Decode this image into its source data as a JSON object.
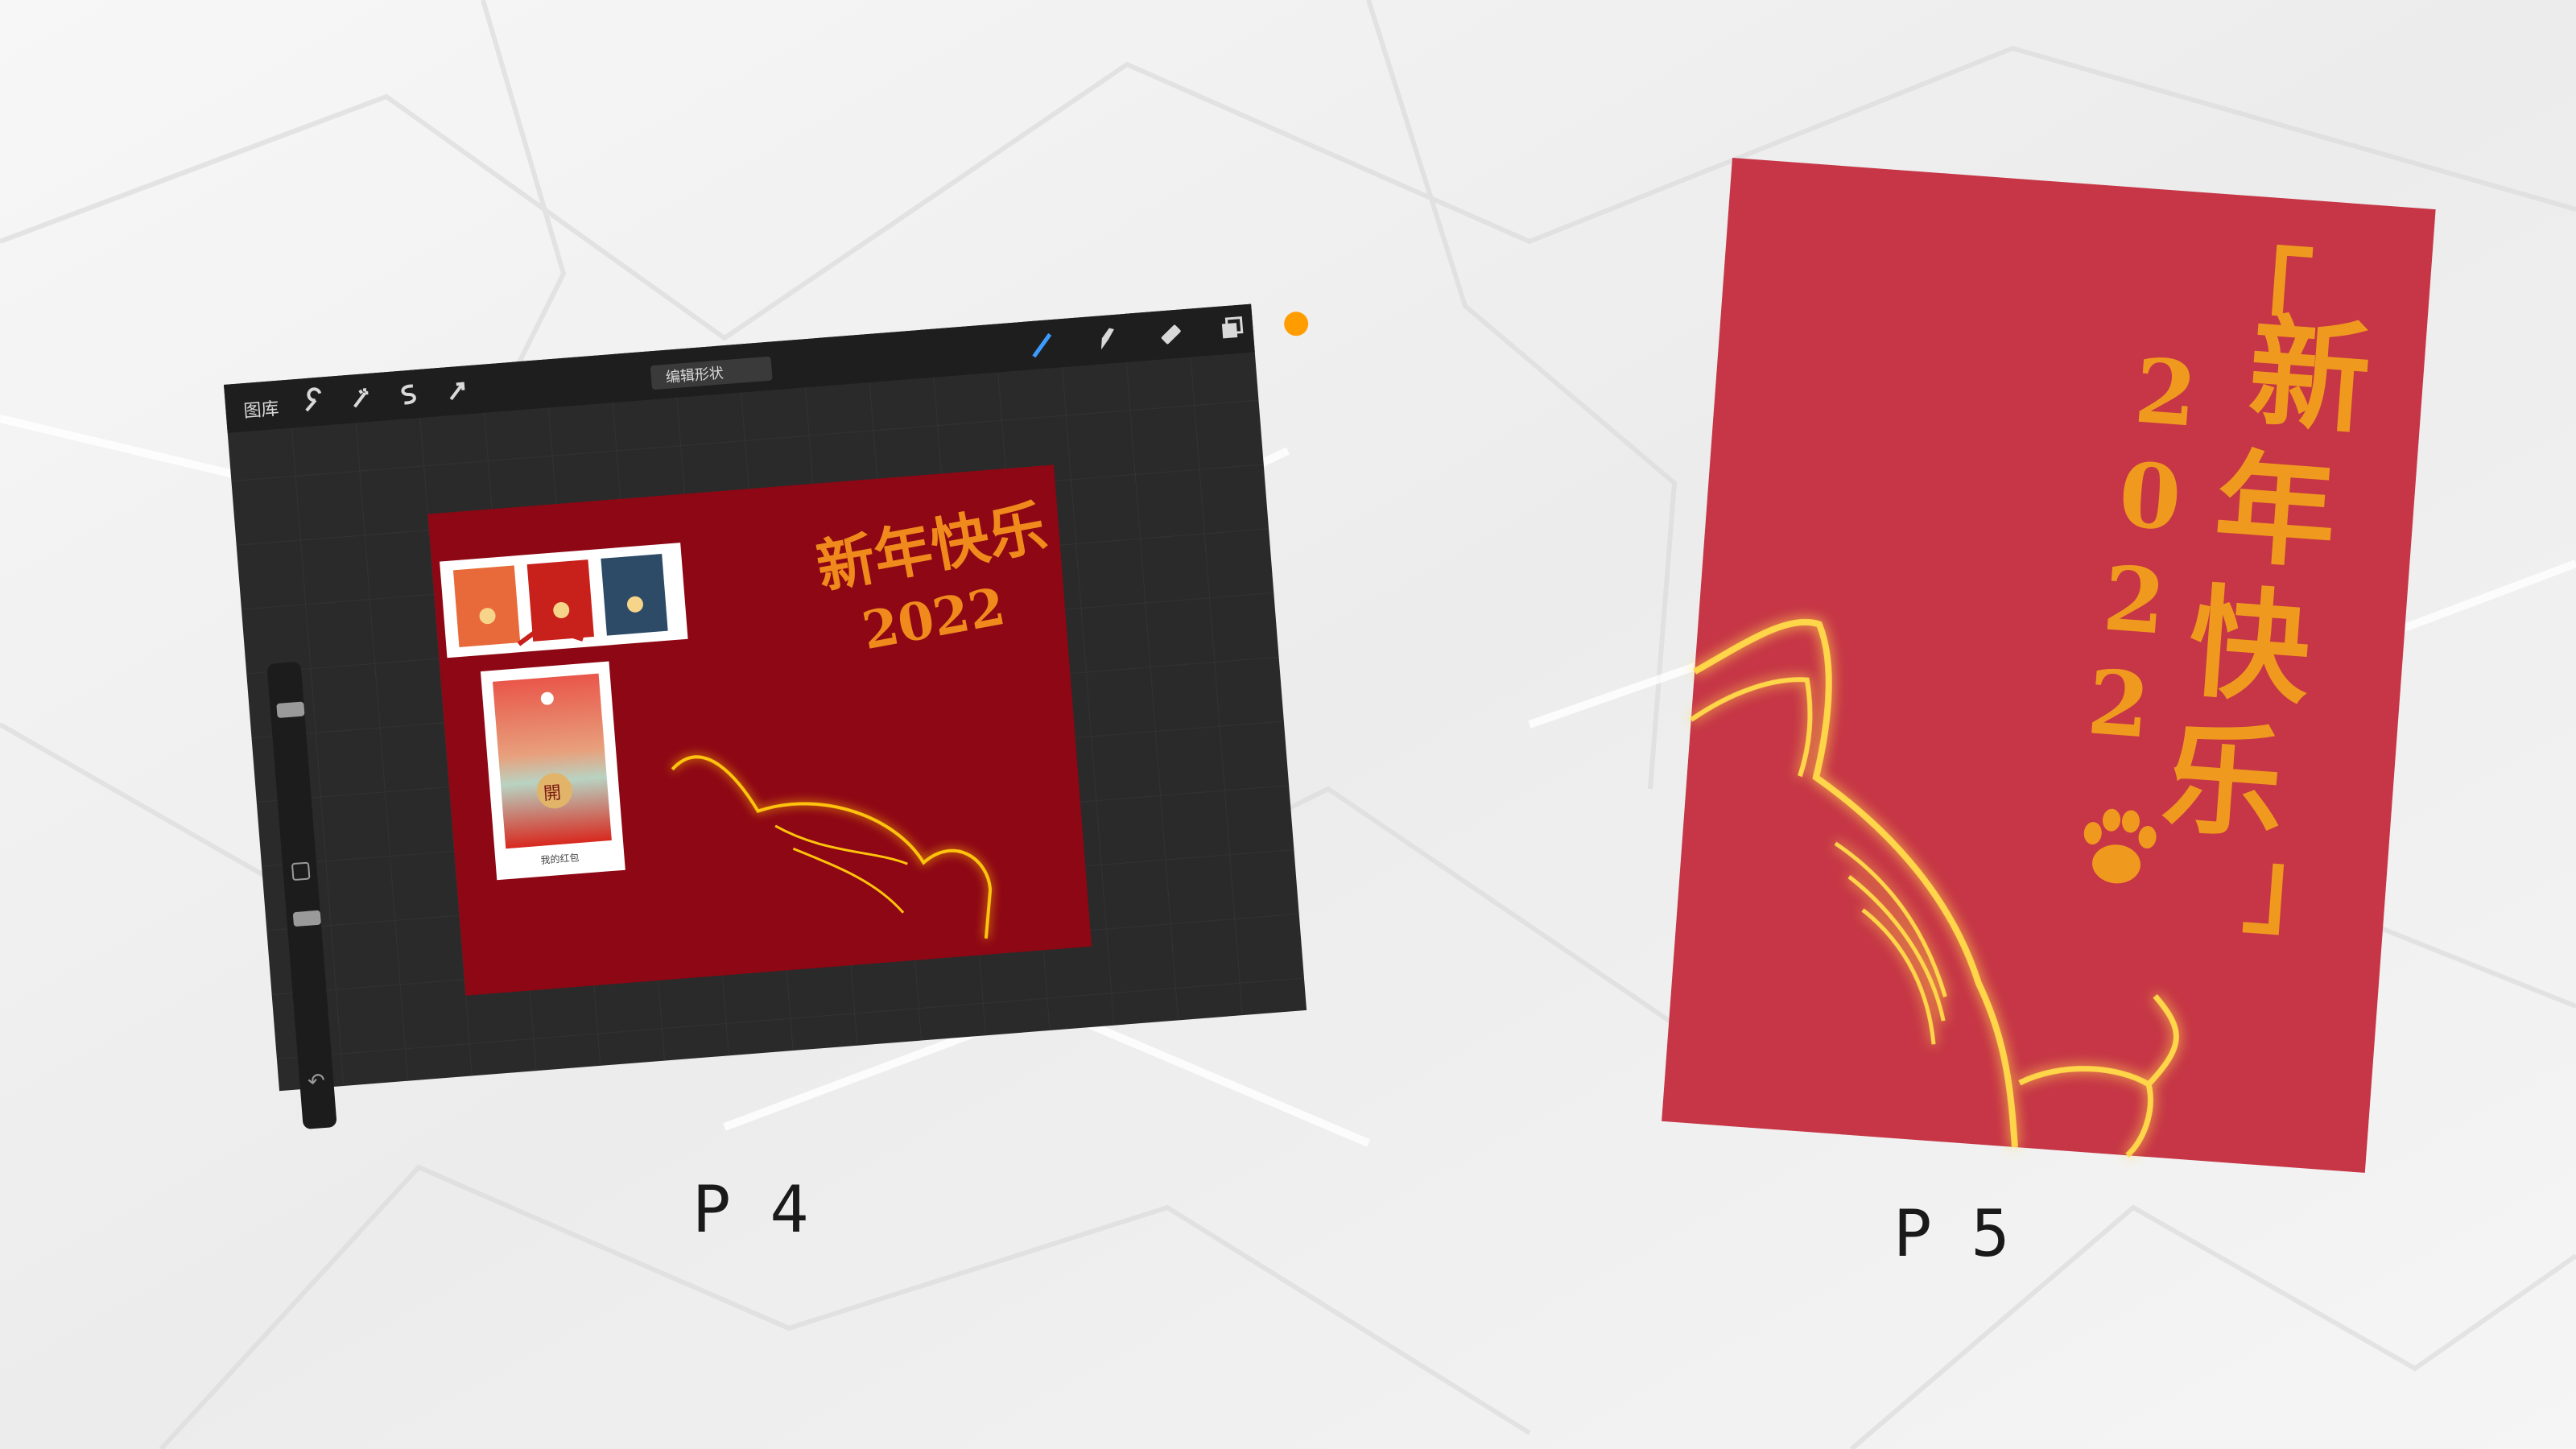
{
  "procreate": {
    "gallery_label": "图库",
    "center_label": "编辑形状",
    "canvas_title": "新年快乐",
    "canvas_year": "2022",
    "card_label": "我的红包",
    "card_badge": "開",
    "colors": {
      "chrome": "#2a2a2a",
      "canvas": "#8e0714",
      "accent": "#ff9d00"
    }
  },
  "poster": {
    "title_chars": [
      "「",
      "新",
      "年",
      "快",
      "乐",
      "」"
    ],
    "year_digits": [
      "2",
      "0",
      "2",
      "2"
    ],
    "paw_icon": "paw-print-icon",
    "colors": {
      "background": "#c63646",
      "lettering": "#ef9a1f",
      "glow": "#ffd54a"
    }
  },
  "captions": {
    "left": "P 4",
    "right": "P 5"
  }
}
